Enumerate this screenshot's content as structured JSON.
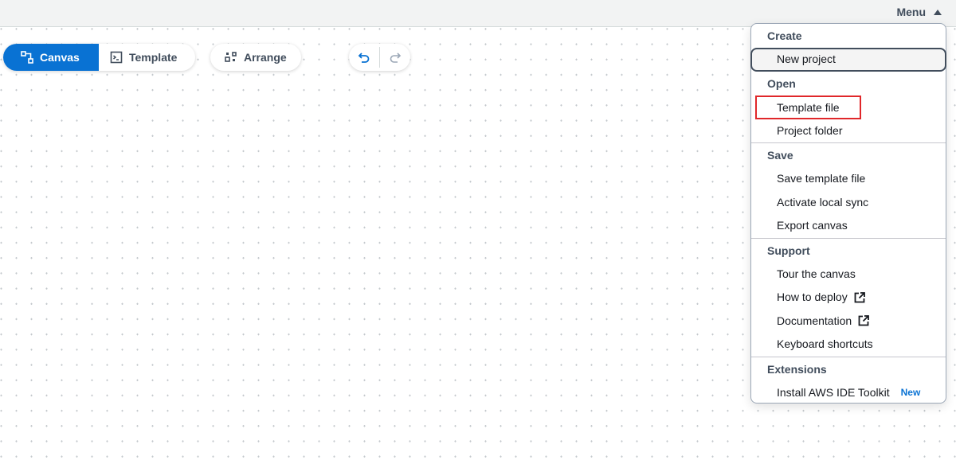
{
  "topbar": {
    "menu_label": "Menu"
  },
  "toolbar": {
    "view_tabs": [
      {
        "label": "Canvas",
        "icon": "canvas-icon",
        "active": true
      },
      {
        "label": "Template",
        "icon": "template-icon",
        "active": false
      }
    ],
    "arrange_label": "Arrange",
    "undo_icon": "undo-icon",
    "redo_icon": "redo-icon"
  },
  "menu": {
    "groups": [
      {
        "label": "Create",
        "items": [
          {
            "label": "New project"
          }
        ]
      },
      {
        "label": "Open",
        "items": [
          {
            "label": "Template file"
          },
          {
            "label": "Project folder"
          }
        ]
      },
      {
        "label": "Save",
        "items": [
          {
            "label": "Save template file"
          },
          {
            "label": "Activate local sync"
          },
          {
            "label": "Export canvas"
          }
        ]
      },
      {
        "label": "Support",
        "items": [
          {
            "label": "Tour the canvas"
          },
          {
            "label": "How to deploy",
            "icon": "external-link-icon"
          },
          {
            "label": "Documentation",
            "icon": "external-link-icon"
          },
          {
            "label": "Keyboard shortcuts"
          }
        ]
      },
      {
        "label": "Extensions",
        "items": [
          {
            "label": "Install AWS IDE Toolkit",
            "badge": "New"
          }
        ]
      }
    ]
  },
  "colors": {
    "primary": "#0972d3",
    "highlight_box": "#e0272a",
    "text": "#16191f",
    "muted": "#414d5c"
  }
}
